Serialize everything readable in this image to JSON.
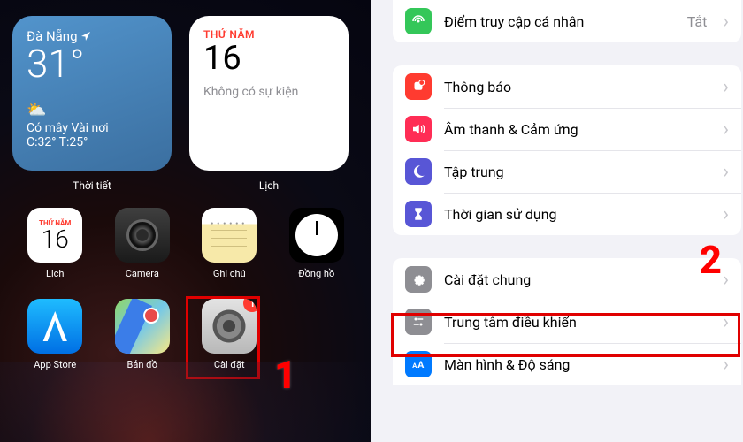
{
  "left": {
    "weather": {
      "city": "Đà Nẵng",
      "temp": "31°",
      "desc": "Có mây Vài nơi",
      "range": "C:32° T:25°",
      "label": "Thời tiết"
    },
    "calendar_widget": {
      "dayname": "THỨ NĂM",
      "daynum": "16",
      "event": "Không có sự kiện",
      "label": "Lịch"
    },
    "apps": {
      "cal": {
        "dayname": "THỨ NĂM",
        "daynum": "16",
        "label": "Lịch"
      },
      "camera": {
        "label": "Camera"
      },
      "notes": {
        "label": "Ghi chú"
      },
      "clock": {
        "label": "Đồng hồ"
      },
      "appstore": {
        "label": "App Store"
      },
      "maps": {
        "label": "Bản đồ"
      },
      "settings": {
        "label": "Cài đặt",
        "badge": "1"
      }
    },
    "step": "1"
  },
  "right": {
    "rows": {
      "hotspot": {
        "label": "Điểm truy cập cá nhân",
        "value": "Tắt"
      },
      "notif": {
        "label": "Thông báo"
      },
      "sound": {
        "label": "Âm thanh & Cảm ứng"
      },
      "focus": {
        "label": "Tập trung"
      },
      "screentime": {
        "label": "Thời gian sử dụng"
      },
      "general": {
        "label": "Cài đặt chung"
      },
      "control": {
        "label": "Trung tâm điều khiển"
      },
      "display": {
        "label": "Màn hình & Độ sáng"
      }
    },
    "step": "2"
  }
}
